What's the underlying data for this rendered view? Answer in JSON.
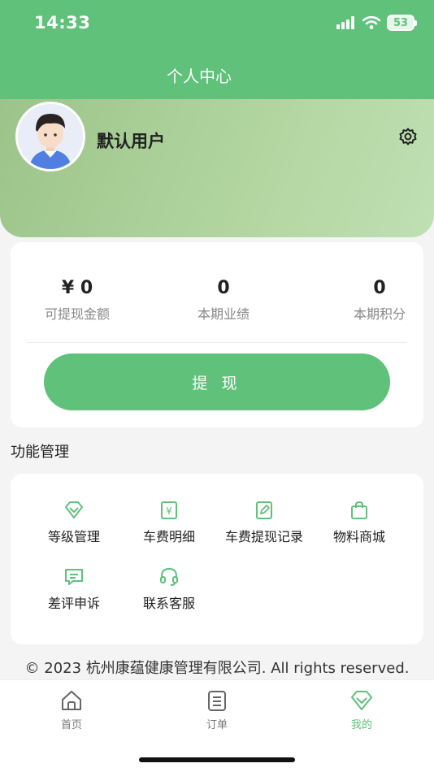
{
  "status_bar": {
    "time": "14:33",
    "battery": "53"
  },
  "nav": {
    "title": "个人中心"
  },
  "profile": {
    "username": "默认用户"
  },
  "stats": [
    {
      "value": "¥ 0",
      "label": "可提现金额"
    },
    {
      "value": "0",
      "label": "本期业绩"
    },
    {
      "value": "0",
      "label": "本期积分"
    }
  ],
  "withdraw_label": "提 现",
  "functions": {
    "title": "功能管理",
    "items": [
      {
        "label": "等级管理",
        "icon": "diamond-icon"
      },
      {
        "label": "车费明细",
        "icon": "yen-doc-icon"
      },
      {
        "label": "车费提现记录",
        "icon": "edit-doc-icon"
      },
      {
        "label": "物料商城",
        "icon": "shopping-bag-icon"
      },
      {
        "label": "差评申诉",
        "icon": "message-icon"
      },
      {
        "label": "联系客服",
        "icon": "headset-icon"
      }
    ]
  },
  "footer": {
    "copyright": "© 2023 杭州康蕴健康管理有限公司. All rights reserved."
  },
  "tabbar": {
    "items": [
      {
        "label": "首页",
        "icon": "home-icon"
      },
      {
        "label": "订单",
        "icon": "order-icon"
      },
      {
        "label": "我的",
        "icon": "profile-diamond-icon"
      }
    ]
  },
  "colors": {
    "accent": "#5fc17a",
    "hero_start": "#9cc48a",
    "hero_end": "#bfe0b3"
  }
}
